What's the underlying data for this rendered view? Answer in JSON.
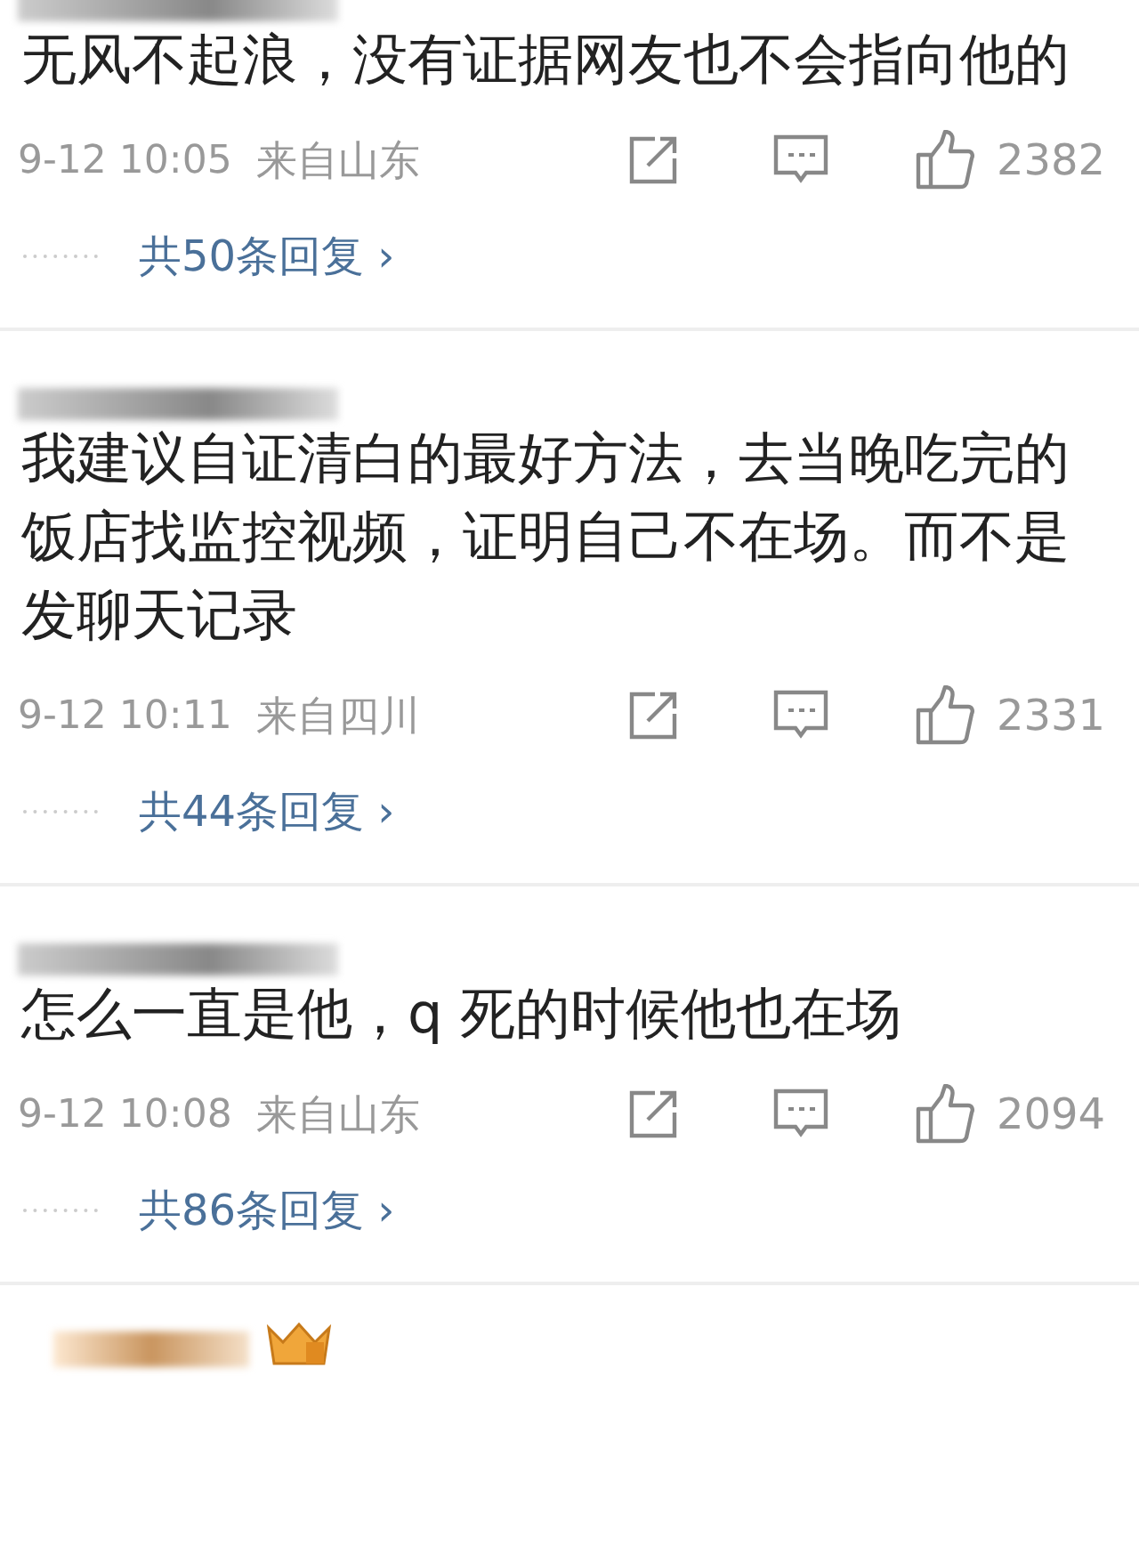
{
  "comments": [
    {
      "text": "无风不起浪，没有证据网友也不会指向他的",
      "time": "9-12 10:05",
      "location": "来自山东",
      "likes": "2382",
      "replies": "共50条回复",
      "reply_arrow": "›"
    },
    {
      "text": "我建议自证清白的最好方法，去当晚吃完的饭店找监控视频，证明自己不在场。而不是发聊天记录",
      "time": "9-12 10:11",
      "location": "来自四川",
      "likes": "2331",
      "replies": "共44条回复",
      "reply_arrow": "›"
    },
    {
      "text": "怎么一直是他，q 死的时候他也在场",
      "time": "9-12 10:08",
      "location": "来自山东",
      "likes": "2094",
      "replies": "共86条回复",
      "reply_arrow": "›"
    }
  ]
}
